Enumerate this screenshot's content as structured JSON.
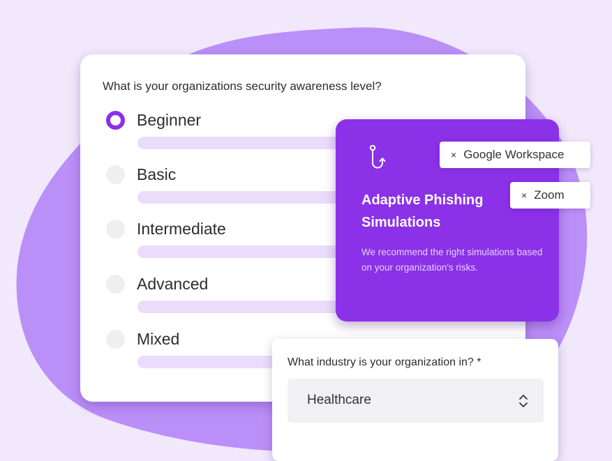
{
  "survey": {
    "question": "What is your organizations security awareness level?",
    "selected": "Beginner",
    "options": [
      {
        "label": "Beginner",
        "selected": true
      },
      {
        "label": "Basic",
        "selected": false
      },
      {
        "label": "Intermediate",
        "selected": false
      },
      {
        "label": "Advanced",
        "selected": false
      },
      {
        "label": "Mixed",
        "selected": false
      }
    ]
  },
  "promo": {
    "icon": "hook-icon",
    "title": "Adaptive Phishing Simulations",
    "description": "We recommend the right simulations based on your organization's risks."
  },
  "tags": [
    {
      "label": "Google Workspace",
      "remove": "×"
    },
    {
      "label": "Zoom",
      "remove": "×"
    }
  ],
  "industry": {
    "question": "What industry is your organization in? *",
    "value": "Healthcare",
    "icon": "chevron-up-down-icon"
  },
  "colors": {
    "accent": "#8b31e8",
    "blob": "#bb8ff8",
    "background": "#f1e8fc",
    "option_bar": "#ebdcfb"
  }
}
